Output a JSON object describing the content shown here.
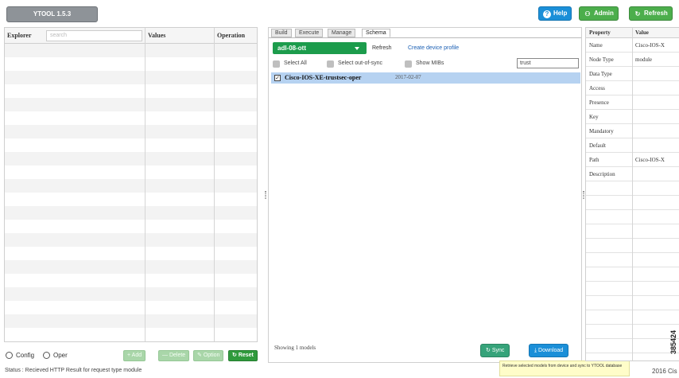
{
  "app": {
    "title": "YTOOL 1.5.3"
  },
  "header": {
    "help_label": "Help",
    "admin_label": "Admin",
    "refresh_label": "Refresh"
  },
  "explorer": {
    "columns": [
      "Explorer",
      "Values",
      "Operation"
    ],
    "search_placeholder": "search",
    "config_label": "Config",
    "oper_label": "Oper",
    "add_label": "+ Add",
    "delete_label": "— Delete",
    "option_label": "Option",
    "reset_label": "Reset"
  },
  "status": {
    "text": "Status : Recieved HTTP Result for request type module"
  },
  "tabs": [
    {
      "label": "Build",
      "active": false
    },
    {
      "label": "Execute",
      "active": false
    },
    {
      "label": "Manage",
      "active": false
    },
    {
      "label": "Schema",
      "active": true
    }
  ],
  "schema": {
    "device": "adl-08-ott",
    "refresh_label": "Refresh",
    "create_profile_label": "Create device profile",
    "select_all_label": "Select All",
    "select_out_of_sync_label": "Select out-of-sync",
    "show_mibs_label": "Show MIBs",
    "filter_value": "trust",
    "model_name": "Cisco-IOS-XE-trustsec-oper",
    "model_date": "2017-02-07",
    "showing_text": "Showing 1 models",
    "sync_label": "Sync",
    "download_label": "Download",
    "tooltip_text": "Retrieve selected models from device and sync to YTOOL database"
  },
  "properties": {
    "header": [
      "Property",
      "Value"
    ],
    "rows": [
      {
        "key": "Name",
        "value": "Cisco-IOS-X"
      },
      {
        "key": "Node Type",
        "value": "module"
      },
      {
        "key": "Data Type",
        "value": ""
      },
      {
        "key": "Access",
        "value": ""
      },
      {
        "key": "Presence",
        "value": ""
      },
      {
        "key": "Key",
        "value": ""
      },
      {
        "key": "Mandatory",
        "value": ""
      },
      {
        "key": "Default",
        "value": ""
      },
      {
        "key": "Path",
        "value": "Cisco-IOS-X"
      },
      {
        "key": "Description",
        "value": ""
      }
    ]
  },
  "footer": {
    "right_text": "2016 Cis",
    "figure_id": "385424"
  },
  "colors": {
    "primary_blue": "#1b8fd8",
    "green": "#4cae4c",
    "device_green": "#1c9c4c",
    "selection_blue": "#b6d2f1"
  }
}
